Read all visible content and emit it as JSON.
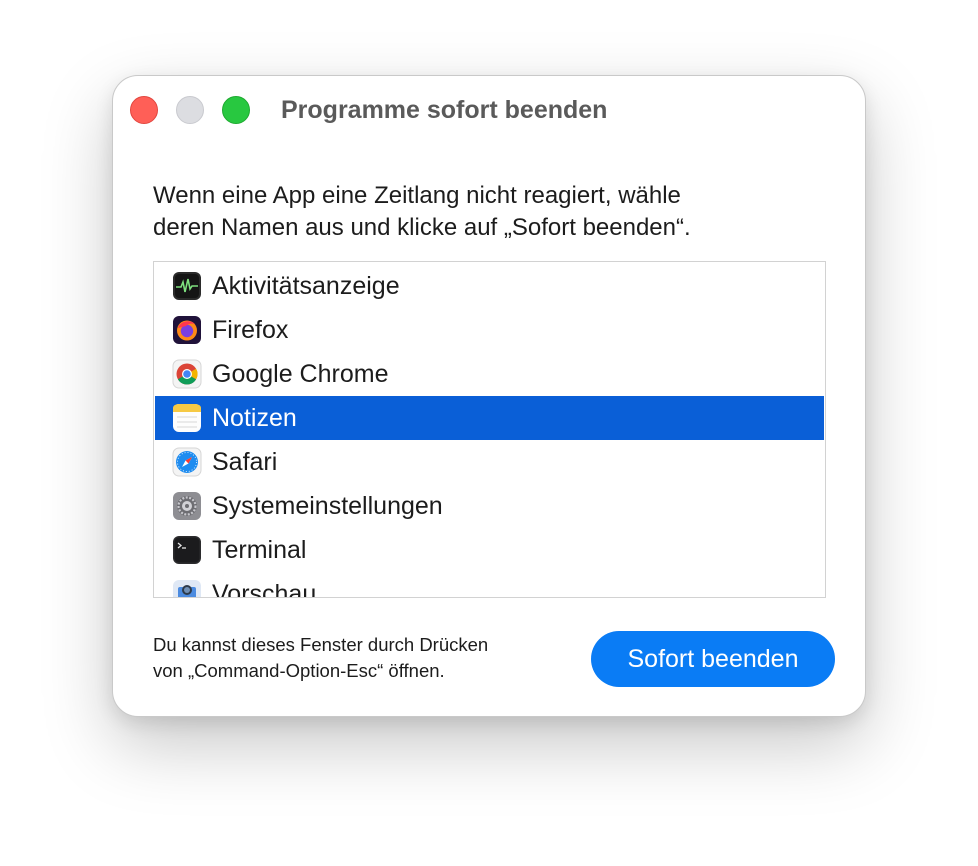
{
  "window": {
    "title": "Programme sofort beenden"
  },
  "description": {
    "line1": "Wenn eine App eine Zeitlang nicht reagiert, wähle",
    "line2": "deren Namen aus und klicke auf „Sofort beenden“."
  },
  "apps": [
    {
      "label": "Aktivitätsanzeige",
      "icon": "activity-monitor-icon",
      "selected": false
    },
    {
      "label": "Firefox",
      "icon": "firefox-icon",
      "selected": false
    },
    {
      "label": "Google Chrome",
      "icon": "chrome-icon",
      "selected": false
    },
    {
      "label": "Notizen",
      "icon": "notes-icon",
      "selected": true
    },
    {
      "label": "Safari",
      "icon": "safari-icon",
      "selected": false
    },
    {
      "label": "Systemeinstellungen",
      "icon": "system-settings-icon",
      "selected": false
    },
    {
      "label": "Terminal",
      "icon": "terminal-icon",
      "selected": false
    },
    {
      "label": "Vorschau",
      "icon": "preview-icon",
      "selected": false
    }
  ],
  "hint": {
    "line1": "Du kannst dieses Fenster durch Drücken",
    "line2": "von „Command-Option-Esc“ öffnen."
  },
  "buttons": {
    "force_quit": "Sofort beenden"
  },
  "colors": {
    "selection": "#0a5fd7",
    "button": "#0a7cf5",
    "close": "#ff5f57",
    "minimize": "#dcdde1",
    "zoom": "#28c840"
  }
}
